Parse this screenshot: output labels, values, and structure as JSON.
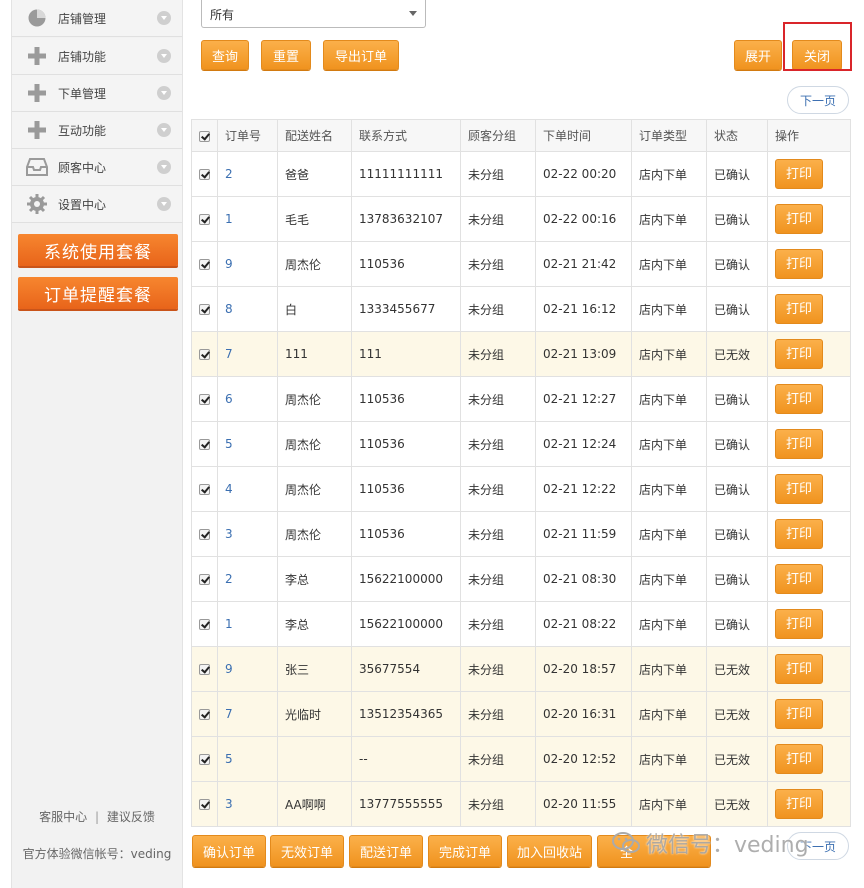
{
  "sidebar": {
    "items": [
      {
        "label": "店铺管理",
        "icon": "pie-chart-icon"
      },
      {
        "label": "店铺功能",
        "icon": "plus-icon"
      },
      {
        "label": "下单管理",
        "icon": "plus-icon"
      },
      {
        "label": "互动功能",
        "icon": "plus-icon"
      },
      {
        "label": "顾客中心",
        "icon": "inbox-icon"
      },
      {
        "label": "设置中心",
        "icon": "gear-icon"
      }
    ],
    "packages": [
      "系统使用套餐",
      "订单提醒套餐"
    ],
    "footer_links": [
      "客服中心",
      "建议反馈"
    ],
    "footer_sep": "|",
    "account_label": "官方体验微信帐号：veding"
  },
  "filter": {
    "status_value": "所有"
  },
  "toolbar": {
    "query": "查询",
    "reset": "重置",
    "export": "导出订单",
    "expand": "展开",
    "close": "关闭"
  },
  "pager": {
    "next": "下一页"
  },
  "table": {
    "headers": [
      "订单号",
      "配送姓名",
      "联系方式",
      "顾客分组",
      "下单时间",
      "订单类型",
      "状态",
      "操作"
    ],
    "action_label": "打印",
    "rows": [
      {
        "id": "2",
        "name": "爸爸",
        "contact": "11111111111",
        "group": "未分组",
        "time": "02-22 00:20",
        "type": "店内下单",
        "status": "已确认"
      },
      {
        "id": "1",
        "name": "毛毛",
        "contact": "13783632107",
        "group": "未分组",
        "time": "02-22 00:16",
        "type": "店内下单",
        "status": "已确认"
      },
      {
        "id": "9",
        "name": "周杰伦",
        "contact": "110536",
        "group": "未分组",
        "time": "02-21 21:42",
        "type": "店内下单",
        "status": "已确认"
      },
      {
        "id": "8",
        "name": "白",
        "contact": "1333455677",
        "group": "未分组",
        "time": "02-21 16:12",
        "type": "店内下单",
        "status": "已确认"
      },
      {
        "id": "7",
        "name": "111",
        "contact": "111",
        "group": "未分组",
        "time": "02-21 13:09",
        "type": "店内下单",
        "status": "已无效"
      },
      {
        "id": "6",
        "name": "周杰伦",
        "contact": "110536",
        "group": "未分组",
        "time": "02-21 12:27",
        "type": "店内下单",
        "status": "已确认"
      },
      {
        "id": "5",
        "name": "周杰伦",
        "contact": "110536",
        "group": "未分组",
        "time": "02-21 12:24",
        "type": "店内下单",
        "status": "已确认"
      },
      {
        "id": "4",
        "name": "周杰伦",
        "contact": "110536",
        "group": "未分组",
        "time": "02-21 12:22",
        "type": "店内下单",
        "status": "已确认"
      },
      {
        "id": "3",
        "name": "周杰伦",
        "contact": "110536",
        "group": "未分组",
        "time": "02-21 11:59",
        "type": "店内下单",
        "status": "已确认"
      },
      {
        "id": "2",
        "name": "李总",
        "contact": "15622100000",
        "group": "未分组",
        "time": "02-21 08:30",
        "type": "店内下单",
        "status": "已确认"
      },
      {
        "id": "1",
        "name": "李总",
        "contact": "15622100000",
        "group": "未分组",
        "time": "02-21 08:22",
        "type": "店内下单",
        "status": "已确认"
      },
      {
        "id": "9",
        "name": "张三",
        "contact": "35677554",
        "group": "未分组",
        "time": "02-20 18:57",
        "type": "店内下单",
        "status": "已无效"
      },
      {
        "id": "7",
        "name": "光临时",
        "contact": "13512354365",
        "group": "未分组",
        "time": "02-20 16:31",
        "type": "店内下单",
        "status": "已无效"
      },
      {
        "id": "5",
        "name": "",
        "contact": "--",
        "group": "未分组",
        "time": "02-20 12:52",
        "type": "店内下单",
        "status": "已无效"
      },
      {
        "id": "3",
        "name": "AA啊啊",
        "contact": "13777555555",
        "group": "未分组",
        "time": "02-20 11:55",
        "type": "店内下单",
        "status": "已无效"
      }
    ]
  },
  "bulk_actions": {
    "confirm": "确认订单",
    "invalid": "无效订单",
    "deliver": "配送订单",
    "complete": "完成订单",
    "recycle": "加入回收站",
    "extra": "全"
  },
  "watermark": {
    "text": "微信号：veding"
  },
  "colors": {
    "accent_orange": "#f0931f",
    "package_orange": "#e8641a",
    "link_blue": "#3b6fb1",
    "highlight_red": "#d9252a",
    "invalid_row_bg": "#fdf8e7"
  }
}
